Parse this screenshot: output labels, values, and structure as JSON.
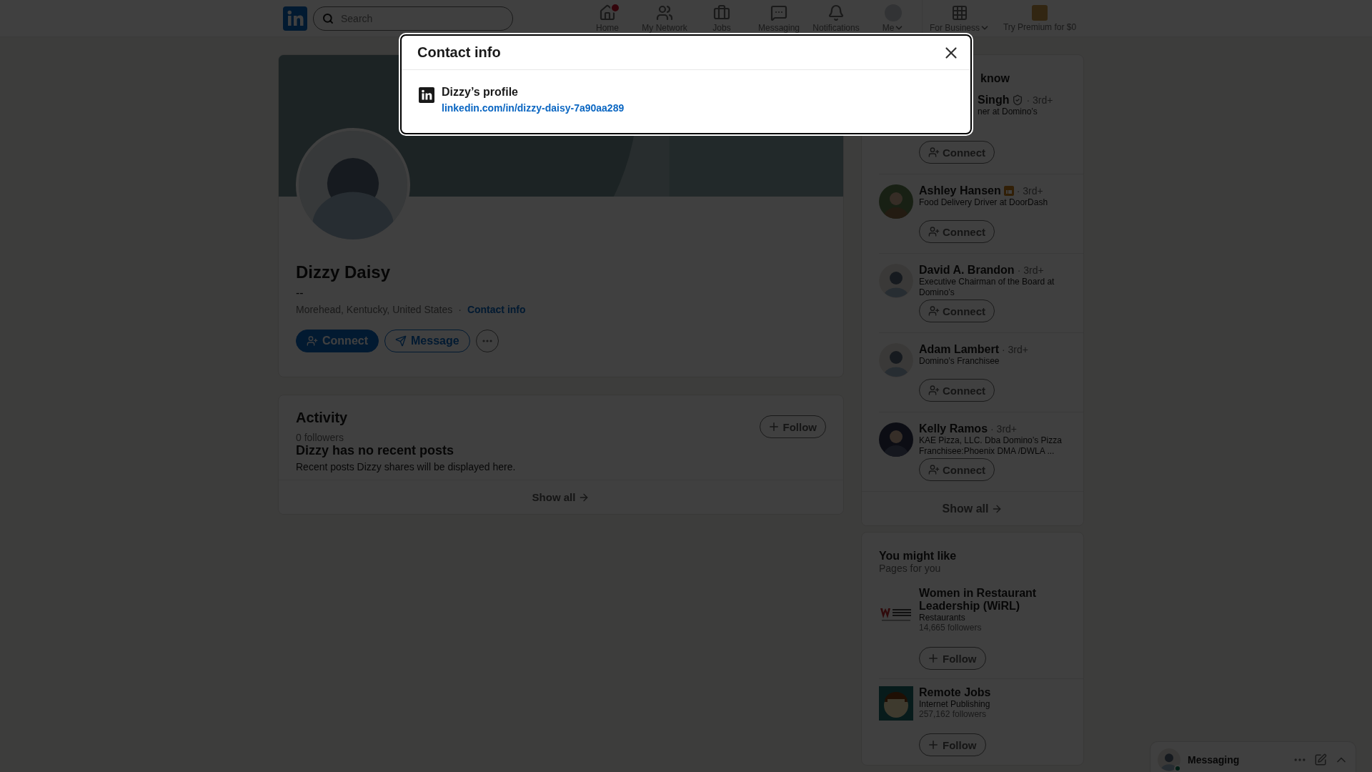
{
  "nav": {
    "search": {
      "placeholder": "Search"
    },
    "items": [
      {
        "label": "Home",
        "badge": true
      },
      {
        "label": "My Network",
        "badge": false
      },
      {
        "label": "Jobs",
        "badge": false
      },
      {
        "label": "Messaging",
        "badge": false
      },
      {
        "label": "Notifications",
        "badge": false
      },
      {
        "label": "Me",
        "badge": false,
        "dropdown": true
      }
    ],
    "business": {
      "label": "For Business"
    },
    "premium": {
      "label": "Try Premium for $0"
    }
  },
  "profile": {
    "name": "Dizzy Daisy",
    "headline": "--",
    "location": "Morehead, Kentucky, United States",
    "separator": "·",
    "contact_link": "Contact info",
    "actions": [
      {
        "kind": "primary",
        "label": "Connect"
      },
      {
        "kind": "outline",
        "label": "Message"
      },
      {
        "kind": "more"
      }
    ]
  },
  "activity": {
    "title": "Activity",
    "followers": "0 followers",
    "follow": "Follow",
    "empty_title": "Dizzy has no recent posts",
    "empty_text": "Recent posts Dizzy shares will be displayed here.",
    "show_all": "Show all"
  },
  "people": {
    "heading": "know",
    "show_all": "Show all",
    "items": [
      {
        "kind": "cropped",
        "name": "Singh",
        "verified": true,
        "degree": "· 3rd+",
        "headline": "ner at Domino’s",
        "button": "Connect"
      },
      {
        "name": "Ashley Hansen",
        "premium": true,
        "degree": "· 3rd+",
        "headline": "Food Delivery Driver at DoorDash",
        "button": "Connect"
      },
      {
        "kind": "default",
        "name": "David A. Brandon",
        "degree": "· 3rd+",
        "headline": "Executive Chairman of the Board at Domino’s",
        "button": "Connect"
      },
      {
        "kind": "default",
        "name": "Adam Lambert",
        "degree": "· 3rd+",
        "headline": "Domino’s Franchisee",
        "button": "Connect"
      },
      {
        "name": "Kelly Ramos",
        "degree": "· 3rd+",
        "headline": "KAE Pizza, LLC. Dba Domino’s Pizza Franchisee:Phoenix DMA /DWLA ...",
        "button": "Connect"
      }
    ]
  },
  "pages": {
    "title": "You might like",
    "subtitle": "Pages for you",
    "items": [
      {
        "name": "Women in Restaurant Leadership (WiRL)",
        "industry": "Restaurants",
        "followers": "14,665 followers",
        "button": "Follow"
      },
      {
        "name": "Remote Jobs",
        "industry": "Internet Publishing",
        "followers": "257,162 followers",
        "button": "Follow"
      }
    ]
  },
  "messaging": {
    "label": "Messaging",
    "online": true
  },
  "modal": {
    "title": "Contact info",
    "profile_label": "Dizzy’s profile",
    "profile_url": "linkedin.com/in/dizzy-daisy-7a90aa289"
  }
}
